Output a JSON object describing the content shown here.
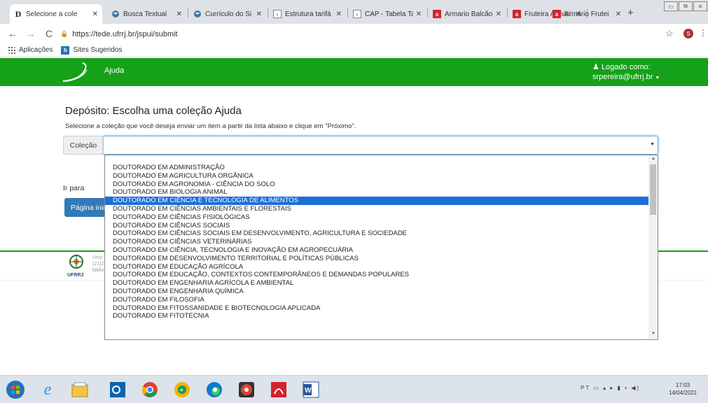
{
  "browser": {
    "tabs": [
      {
        "title": "Selecione a cole",
        "icon": "dspace-icon",
        "active": true
      },
      {
        "title": "Busca Textual",
        "icon": "globe-icon"
      },
      {
        "title": "Currículo do Si",
        "icon": "globe-icon"
      },
      {
        "title": "Estrutura tarifá",
        "icon": "doc-icon"
      },
      {
        "title": "CAP - Tabela Ta",
        "icon": "doc-icon"
      },
      {
        "title": "Armario Balcão",
        "icon": "store-icon"
      },
      {
        "title": "Fruteira Armári",
        "icon": "store-icon"
      },
      {
        "title": "Armário Frutei",
        "icon": "store-icon"
      }
    ],
    "new_tab": "+",
    "url": "https://tede.ufrrj.br/jspui/submit",
    "profile_initial": "S",
    "bookmarks": [
      {
        "label": "Aplicações",
        "icon": "apps-icon"
      },
      {
        "label": "Sites Sugeridos",
        "icon": "bookmark-b-icon"
      }
    ]
  },
  "site": {
    "nav_help": "Ajuda",
    "login_line1": "Logado como:",
    "login_line2": "srpereira@ufrrj.br"
  },
  "page": {
    "heading": "Depósito: Escolha uma coleção Ajuda",
    "instructions": "Selecione a coleção que você deseja enviar um item a partir da lista abaixo e clique em \"Próximo\".",
    "collection_label": "Coleção",
    "collection_value": "",
    "goto_label": "Ir para",
    "home_button": "Página inicial",
    "footer_logo_label": "UFRRJ",
    "footer_lines": [
      "Univ",
      "(21)2",
      "biblio"
    ]
  },
  "dropdown": {
    "selected_index": 4,
    "options": [
      "DOUTORADO EM ADMINISTRAÇÃO",
      "DOUTORADO EM AGRICULTURA ORGÂNICA",
      "DOUTORADO EM AGRONOMIA - CIÊNCIA DO SOLO",
      "DOUTORADO EM BIOLOGIA ANIMAL",
      "DOUTORADO EM CIÊNCIA E TECNOLOGIA DE ALIMENTOS",
      "DOUTORADO EM CIÊNCIAS AMBIENTAIS E FLORESTAIS",
      "DOUTORADO EM CIÊNCIAS FISIOLÓGICAS",
      "DOUTORADO EM CIÊNCIAS SOCIAIS",
      "DOUTORADO EM CIÊNCIAS SOCIAIS EM DESENVOLVIMENTO, AGRICULTURA E SOCIEDADE",
      "DOUTORADO EM CIÊNCIAS VETERINÁRIAS",
      "DOUTORADO EM CIÊNCIA, TECNOLOGIA E INOVAÇÃO EM AGROPECUÁRIA",
      "DOUTORADO EM DESENVOLVIMENTO TERRITORIAL E POLÍTICAS PÚBLICAS",
      "DOUTORADO EM EDUCAÇÃO AGRÍCOLA",
      "DOUTORADO EM EDUCAÇÃO, CONTEXTOS CONTEMPORÂNEOS E DEMANDAS POPULARES",
      "DOUTORADO EM ENGENHARIA AGRÍCOLA E AMBIENTAL",
      "DOUTORADO EM ENGENHARIA QUÍMICA",
      "DOUTORADO EM FILOSOFIA",
      "DOUTORADO EM FITOSSANIDADE E BIOTECNOLOGIA APLICADA",
      "DOUTORADO EM FITOTECNIA"
    ]
  },
  "taskbar": {
    "apps": [
      "start-orb-icon",
      "ie-icon",
      "explorer-icon",
      "outlook-icon",
      "chrome-icon",
      "chrome-canary-icon",
      "edge-icon",
      "chrome-g-icon",
      "pdf-icon",
      "word-icon"
    ],
    "tray_lang": "PT",
    "time": "17:03",
    "date": "14/04/2021"
  },
  "colors": {
    "green": "#16a11a",
    "blue": "#337ab7",
    "selected": "#1e6fd9"
  }
}
